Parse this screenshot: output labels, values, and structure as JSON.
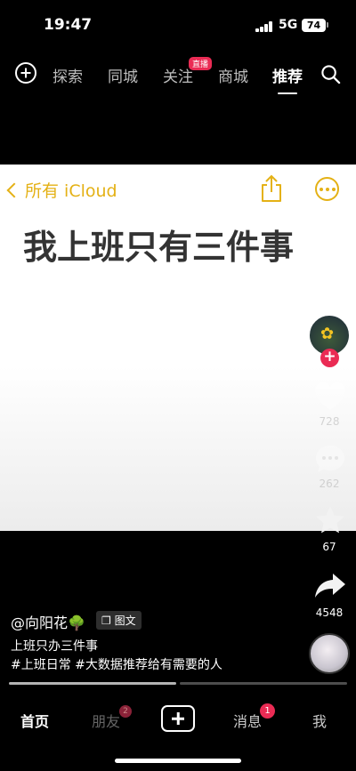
{
  "status_bar": {
    "time": "19:47",
    "network": "5G",
    "battery": "74"
  },
  "top_nav": {
    "tabs": [
      {
        "label": "探索"
      },
      {
        "label": "同城"
      },
      {
        "label": "关注"
      },
      {
        "label": "商城"
      },
      {
        "label": "推荐"
      }
    ],
    "live_badge": "直播",
    "active_tab": "推荐"
  },
  "note": {
    "back_label": "所有 iCloud",
    "title": "我上班只有三件事",
    "accent_color": "#e4b115"
  },
  "actions": {
    "likes": "728",
    "comments": "262",
    "favorites": "67",
    "shares": "4548"
  },
  "post": {
    "author": "@向阳花🌳",
    "type_tag": "图文",
    "caption": "上班只办三件事",
    "hashtags": "#上班日常 #大数据推荐给有需要的人"
  },
  "progress": {
    "pages": 2,
    "current_page": 1
  },
  "bottom_nav": {
    "home": "首页",
    "friends": "朋友",
    "friends_badge": "2",
    "messages": "消息",
    "messages_badge": "1",
    "me": "我"
  },
  "icons": [
    "add-icon",
    "search-icon",
    "share-icon",
    "more-icon",
    "heart-icon",
    "comment-icon",
    "star-icon",
    "forward-icon",
    "create-icon"
  ]
}
